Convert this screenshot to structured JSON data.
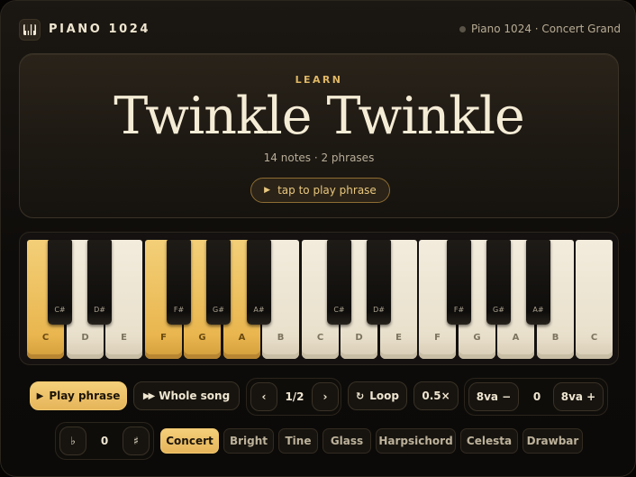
{
  "header": {
    "app_title": "PIANO 1024",
    "status_text": "Piano 1024 · Concert Grand",
    "logo_icon": "piano-keys-icon"
  },
  "hero": {
    "kicker": "LEARN",
    "title": "Twinkle Twinkle",
    "subtitle": "14 notes · 2 phrases",
    "play_button_label": "tap to play phrase",
    "play_icon": "play-icon"
  },
  "keyboard": {
    "white_keys": [
      {
        "label": "C",
        "lit": true
      },
      {
        "label": "D",
        "lit": false
      },
      {
        "label": "E",
        "lit": false
      },
      {
        "label": "F",
        "lit": true
      },
      {
        "label": "G",
        "lit": true
      },
      {
        "label": "A",
        "lit": true
      },
      {
        "label": "B",
        "lit": false
      },
      {
        "label": "C",
        "lit": false
      },
      {
        "label": "D",
        "lit": false
      },
      {
        "label": "E",
        "lit": false
      },
      {
        "label": "F",
        "lit": false
      },
      {
        "label": "G",
        "lit": false
      },
      {
        "label": "A",
        "lit": false
      },
      {
        "label": "B",
        "lit": false
      },
      {
        "label": "C",
        "lit": false
      }
    ],
    "black_keys": [
      "C#",
      "D#",
      "F#",
      "G#",
      "A#",
      "C#",
      "D#",
      "F#",
      "G#",
      "A#"
    ],
    "highlight_color": "#e9b64f"
  },
  "controls": {
    "play_phrase": "Play phrase",
    "whole_song": "Whole song",
    "phrase_prev": "‹",
    "phrase_indicator": "1/2",
    "phrase_next": "›",
    "loop": "Loop",
    "speed": "0.5×",
    "octave_down": "8va −",
    "octave_value": "0",
    "octave_up": "8va +"
  },
  "transpose": {
    "flat": "♭",
    "value": "0",
    "sharp": "♯"
  },
  "sounds": {
    "options": [
      "Concert",
      "Bright",
      "Tine",
      "Glass",
      "Harpsichord",
      "Celesta",
      "Drawbar"
    ],
    "selected": "Concert"
  },
  "colors": {
    "accent": "#f0c870",
    "background": "#0e0c0a"
  }
}
